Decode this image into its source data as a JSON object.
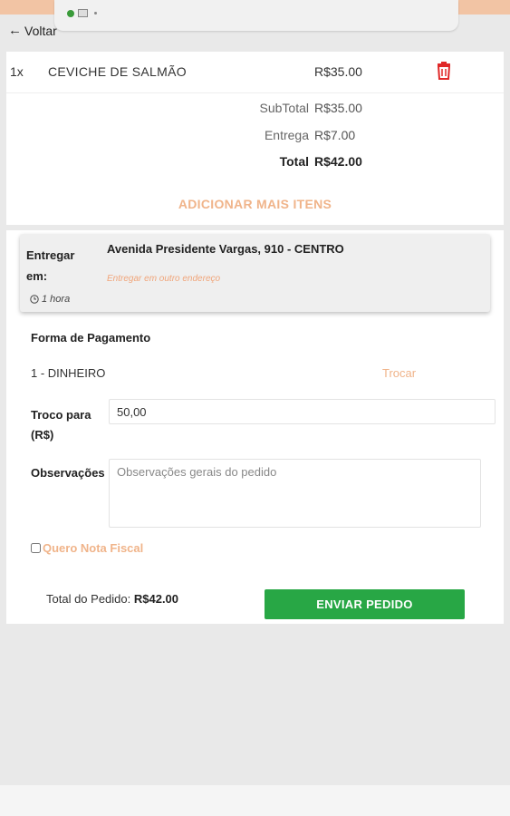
{
  "nav": {
    "back_label": "Voltar"
  },
  "cart": {
    "item": {
      "qty": "1x",
      "name": "CEVICHE DE SALMÃO",
      "price": "R$35.00"
    },
    "subtotal_label": "SubTotal",
    "subtotal_value": "R$35.00",
    "delivery_label": "Entrega",
    "delivery_value": "R$7.00",
    "total_label": "Total",
    "total_value": "R$42.00",
    "add_more_label": "ADICIONAR MAIS ITENS"
  },
  "delivery": {
    "label": "Entregar em:",
    "address": "Avenida Presidente Vargas, 910 - CENTRO",
    "other_address_link": "Entregar em outro endereço",
    "eta": "1 hora"
  },
  "payment": {
    "title": "Forma de Pagamento",
    "method": "1 - DINHEIRO",
    "swap_label": "Trocar",
    "change_label": "Troco para (R$)",
    "change_value": "50,00",
    "notes_label": "Observações",
    "notes_placeholder": "Observações gerais do pedido",
    "invoice_label": "Quero Nota Fiscal"
  },
  "footer": {
    "order_total_label": "Total do Pedido:",
    "order_total_value": "R$42.00",
    "send_button_label": "ENVIAR PEDIDO"
  },
  "colors": {
    "accent": "#f0b48a",
    "button_green": "#28a745",
    "trash_red": "#e02828"
  },
  "icons": [
    "back-arrow-icon",
    "trash-icon",
    "clock-icon",
    "globe-icon",
    "image-icon"
  ]
}
